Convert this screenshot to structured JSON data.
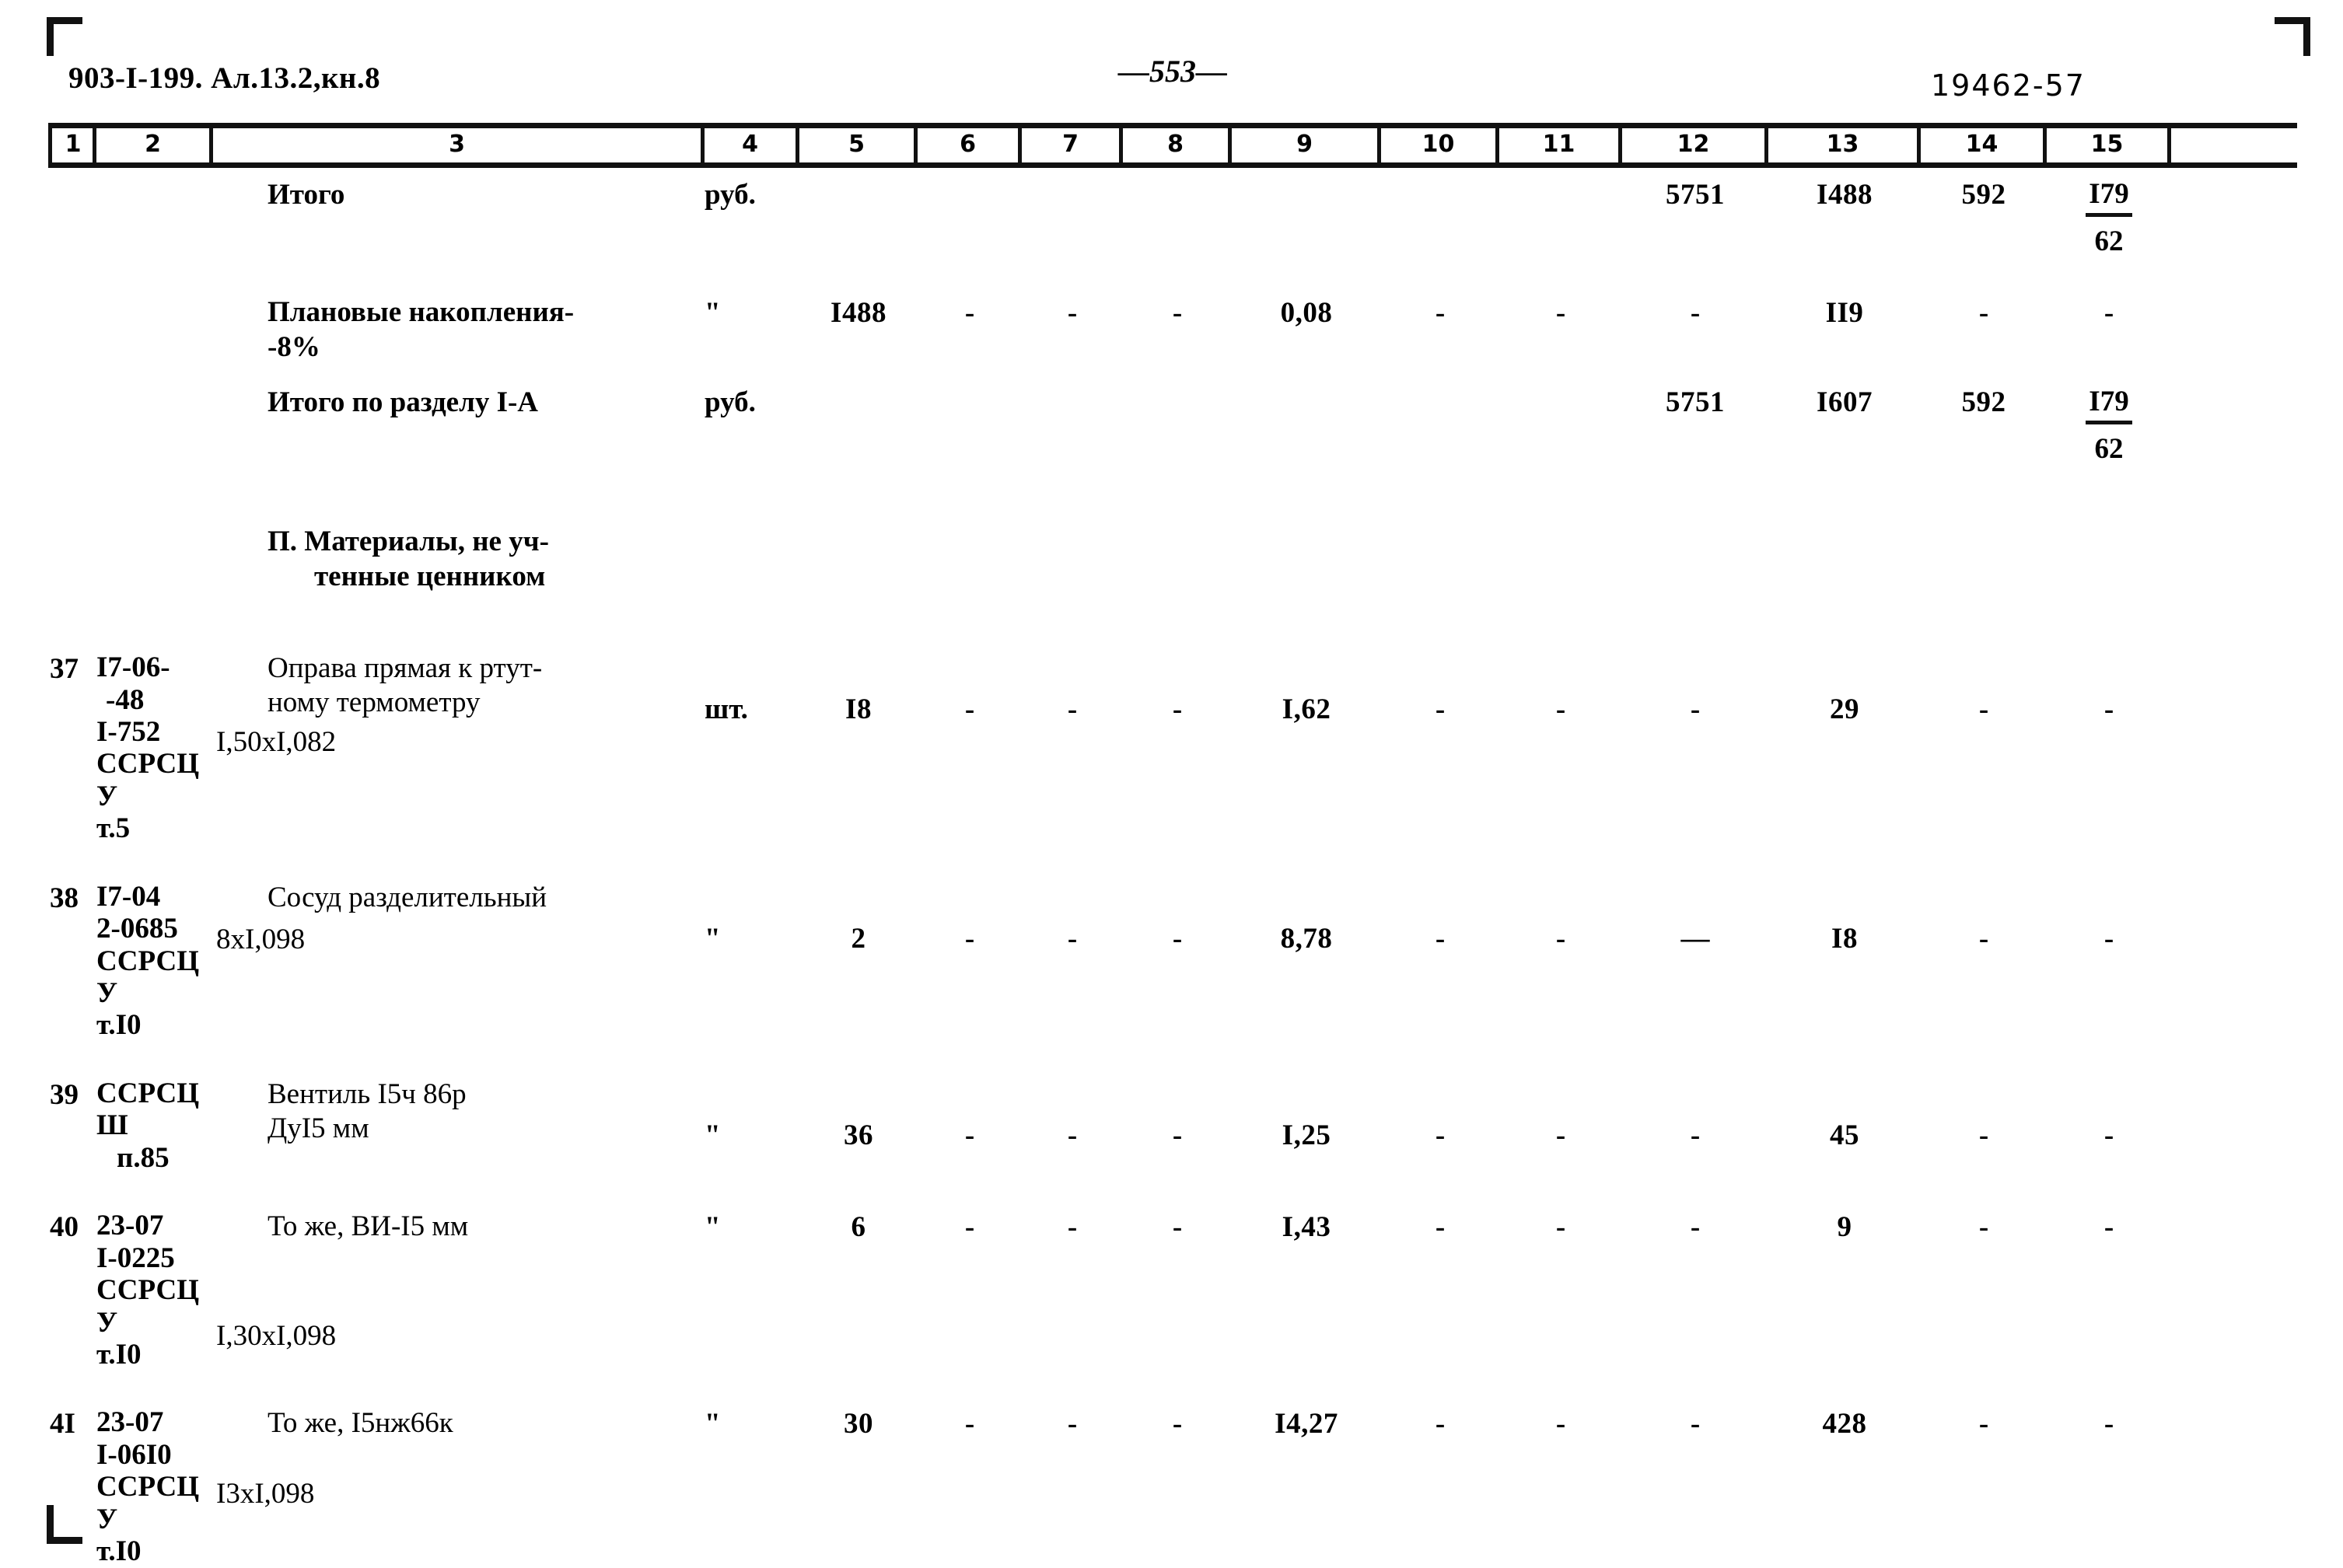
{
  "header": {
    "doc_id": "903-I-199. Ал.13.2,кн.8",
    "page_number": "—553—",
    "archive_number": "19462-57"
  },
  "column_numbers": [
    "1",
    "2",
    "3",
    "4",
    "5",
    "6",
    "7",
    "8",
    "9",
    "10",
    "11",
    "12",
    "13",
    "14",
    "15"
  ],
  "rows": [
    {
      "kind": "total",
      "no": "",
      "code": "",
      "description": "Итого",
      "unit": "руб.",
      "c5": "",
      "c6": "",
      "c7": "",
      "c8": "",
      "c9": "",
      "c10": "",
      "c11": "",
      "c12": "5751",
      "c13": "I488",
      "c14": "592",
      "c15_num": "I79",
      "c15_den": "62"
    },
    {
      "kind": "item",
      "no": "",
      "code": "",
      "description": "Плановые накопления-",
      "description2": "-8%",
      "unit": "\"",
      "c5": "I488",
      "c6": "-",
      "c7": "-",
      "c8": "-",
      "c9": "0,08",
      "c10": "-",
      "c11": "-",
      "c12": "-",
      "c13": "II9",
      "c14": "-",
      "c15": "-"
    },
    {
      "kind": "total",
      "no": "",
      "code": "",
      "description": "Итого по разделу I-А",
      "unit": "руб.",
      "c5": "",
      "c6": "",
      "c7": "",
      "c8": "",
      "c9": "",
      "c10": "",
      "c11": "",
      "c12": "5751",
      "c13": "I607",
      "c14": "592",
      "c15_num": "I79",
      "c15_den": "62"
    },
    {
      "kind": "section",
      "title_line1": "П. Материалы, не уч-",
      "title_line2": "тенные ценником"
    },
    {
      "kind": "item",
      "no": "37",
      "code_lines": [
        "I7-06-",
        "-48",
        "I-752",
        "ССРСЦ У",
        "т.5"
      ],
      "desc_lines": [
        "Оправа прямая к ртут-",
        "ному термометру",
        "I,50xI,082"
      ],
      "unit": "шт.",
      "c5": "I8",
      "c6": "-",
      "c7": "-",
      "c8": "-",
      "c9": "I,62",
      "c10": "-",
      "c11": "-",
      "c12": "-",
      "c13": "29",
      "c14": "-",
      "c15": "-"
    },
    {
      "kind": "item",
      "no": "38",
      "code_lines": [
        "I7-04",
        "2-0685",
        "ССРСЦ У",
        "т.I0"
      ],
      "desc_lines": [
        "Сосуд разделительный",
        "8xI,098"
      ],
      "unit": "\"",
      "c5": "2",
      "c6": "-",
      "c7": "-",
      "c8": "-",
      "c9": "8,78",
      "c10": "-",
      "c11": "-",
      "c12": "—",
      "c13": "I8",
      "c14": "-",
      "c15": "-"
    },
    {
      "kind": "item",
      "no": "39",
      "code_lines": [
        "ССРСЦ Ш",
        "п.85"
      ],
      "desc_lines": [
        "Вентиль I5ч 86р",
        "ДуI5 мм"
      ],
      "unit": "\"",
      "c5": "36",
      "c6": "-",
      "c7": "-",
      "c8": "-",
      "c9": "I,25",
      "c10": "-",
      "c11": "-",
      "c12": "-",
      "c13": "45",
      "c14": "-",
      "c15": "-"
    },
    {
      "kind": "item",
      "no": "40",
      "code_lines": [
        "23-07",
        "I-0225",
        "ССРСЦ У",
        "т.I0"
      ],
      "desc_lines": [
        "То же, ВИ-I5 мм",
        "",
        "",
        "I,30xI,098"
      ],
      "unit": "\"",
      "c5": "6",
      "c6": "-",
      "c7": "-",
      "c8": "-",
      "c9": "I,43",
      "c10": "-",
      "c11": "-",
      "c12": "-",
      "c13": "9",
      "c14": "-",
      "c15": "-"
    },
    {
      "kind": "item",
      "no": "4I",
      "code_lines": [
        "23-07",
        "I-06I0",
        "ССРСЦ У",
        "т.I0"
      ],
      "desc_lines": [
        "То же, I5нж66к",
        "",
        "I3xI,098"
      ],
      "unit": "\"",
      "c5": "30",
      "c6": "-",
      "c7": "-",
      "c8": "-",
      "c9": "I4,27",
      "c10": "-",
      "c11": "-",
      "c12": "-",
      "c13": "428",
      "c14": "-",
      "c15": "-"
    }
  ]
}
